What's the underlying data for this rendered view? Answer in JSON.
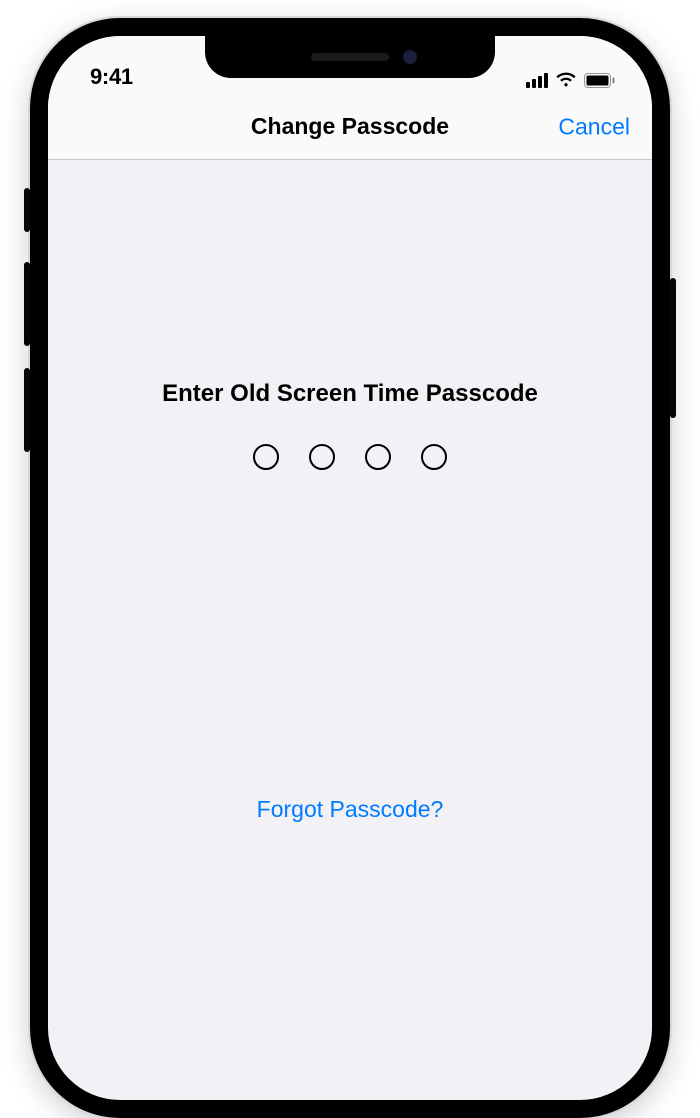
{
  "statusbar": {
    "time": "9:41"
  },
  "navbar": {
    "title": "Change Passcode",
    "cancel": "Cancel"
  },
  "passcode": {
    "prompt": "Enter Old Screen Time Passcode",
    "length": 4,
    "filled": 0
  },
  "links": {
    "forgot": "Forgot Passcode?"
  }
}
